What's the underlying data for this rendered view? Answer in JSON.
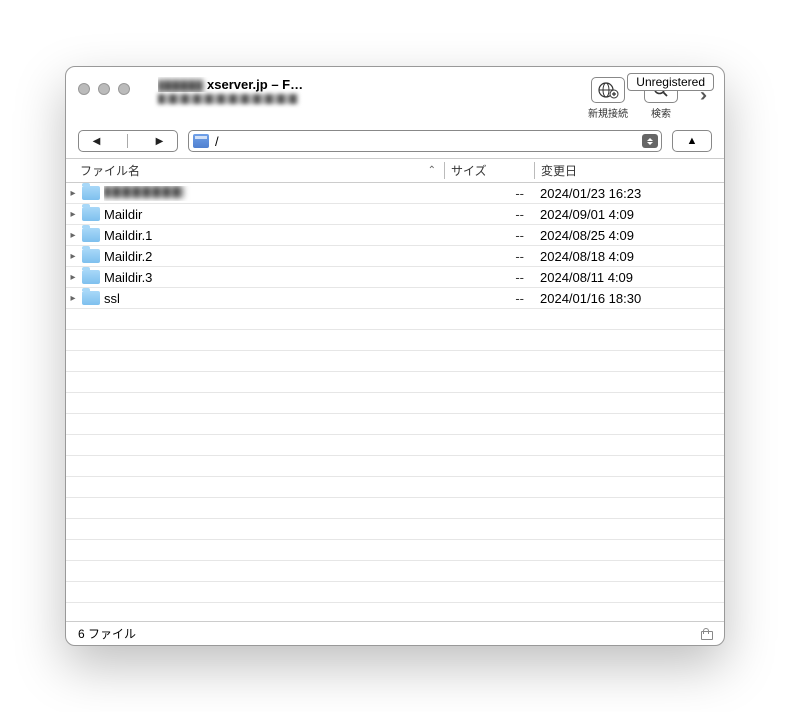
{
  "titlebar": {
    "title_suffix": "xserver.jp – F…",
    "unregistered_label": "Unregistered"
  },
  "toolbar": {
    "new_connection_label": "新規接続",
    "search_label": "検索"
  },
  "path_bar": {
    "path": "/"
  },
  "columns": {
    "name": "ファイル名",
    "size": "サイズ",
    "modified": "変更日"
  },
  "files": [
    {
      "name": "████████",
      "blurred": true,
      "size": "--",
      "modified": "2024/01/23 16:23"
    },
    {
      "name": "Maildir",
      "blurred": false,
      "size": "--",
      "modified": "2024/09/01 4:09"
    },
    {
      "name": "Maildir.1",
      "blurred": false,
      "size": "--",
      "modified": "2024/08/25 4:09"
    },
    {
      "name": "Maildir.2",
      "blurred": false,
      "size": "--",
      "modified": "2024/08/18 4:09"
    },
    {
      "name": "Maildir.3",
      "blurred": false,
      "size": "--",
      "modified": "2024/08/11 4:09"
    },
    {
      "name": "ssl",
      "blurred": false,
      "size": "--",
      "modified": "2024/01/16 18:30"
    }
  ],
  "statusbar": {
    "count_text": "6 ファイル"
  }
}
